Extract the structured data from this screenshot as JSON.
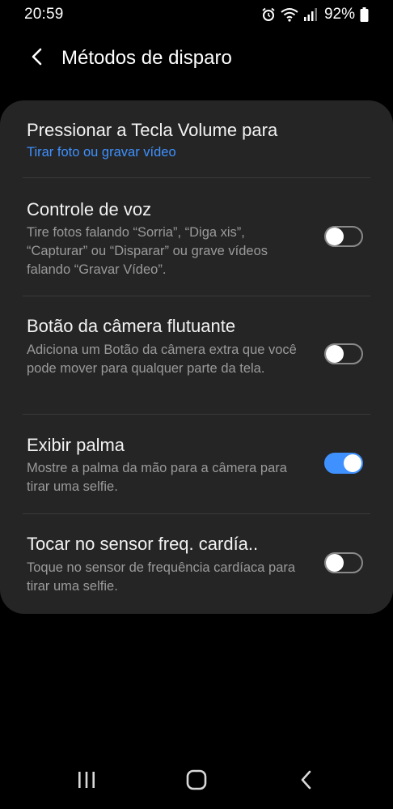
{
  "status_bar": {
    "time": "20:59",
    "battery": "92%"
  },
  "header": {
    "title": "Métodos de disparo"
  },
  "settings": [
    {
      "title": "Pressionar a Tecla Volume para",
      "subtitle": "Tirar foto ou gravar vídeo"
    },
    {
      "title": "Controle de voz",
      "subtitle": "Tire fotos falando “Sorria”, “Diga xis”, “Capturar” ou “Disparar” ou grave vídeos falando “Gravar Vídeo”.",
      "enabled": false
    },
    {
      "title": "Botão da câmera flutuante",
      "subtitle": "Adiciona um Botão da câmera extra que você pode mover para qualquer parte da tela.",
      "enabled": false
    },
    {
      "title": "Exibir palma",
      "subtitle": "Mostre a palma da mão para a câmera para tirar uma selfie.",
      "enabled": true
    },
    {
      "title": "Tocar no sensor freq. cardía..",
      "subtitle": "Toque no sensor de frequência cardíaca para tirar uma selfie.",
      "enabled": false
    }
  ],
  "colors": {
    "background": "#000000",
    "card": "#252525",
    "accent": "#3e91ff",
    "subtitle": "#9a9a9a"
  },
  "icons": {
    "back": "back-arrow-icon",
    "alarm": "alarm-icon",
    "wifi": "wifi-icon",
    "signal": "signal-icon",
    "battery": "battery-icon",
    "nav_recents": "recents-icon",
    "nav_home": "home-icon",
    "nav_back": "nav-back-icon"
  }
}
